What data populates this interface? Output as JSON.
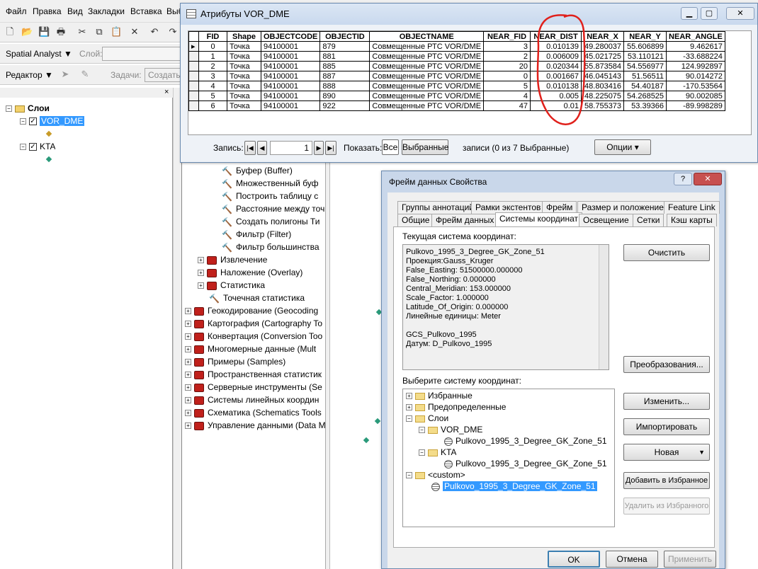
{
  "menu": {
    "items": [
      "Файл",
      "Правка",
      "Вид",
      "Закладки",
      "Вставка",
      "Выб"
    ]
  },
  "toolbar": {
    "spatial_analyst": "Spatial Analyst ▼",
    "layer_label": "Слой:",
    "editor": "Редактор ▼",
    "tasks_label": "Задачи:",
    "create_label": "Создать"
  },
  "toc": {
    "root": "Слои",
    "layers": [
      "VOR_DME",
      "KTA"
    ]
  },
  "toolbox": {
    "items": [
      {
        "label": "Буфер (Buffer)",
        "kind": "tool"
      },
      {
        "label": "Множественный буф",
        "kind": "tool"
      },
      {
        "label": "Построить таблицу с",
        "kind": "tool"
      },
      {
        "label": "Расстояние между точ",
        "kind": "tool"
      },
      {
        "label": "Создать полигоны Ти",
        "kind": "tool"
      },
      {
        "label": "Фильтр (Filter)",
        "kind": "tool"
      },
      {
        "label": "Фильтр большинства",
        "kind": "tool"
      },
      {
        "label": "Извлечение",
        "kind": "set"
      },
      {
        "label": "Наложение (Overlay)",
        "kind": "set"
      },
      {
        "label": "Статистика",
        "kind": "set"
      },
      {
        "label": "Точечная статистика",
        "kind": "tool2"
      },
      {
        "label": "Геокодирование (Geocoding",
        "kind": "box"
      },
      {
        "label": "Картография (Cartography To",
        "kind": "box"
      },
      {
        "label": "Конвертация (Conversion Too",
        "kind": "box"
      },
      {
        "label": "Многомерные данные (Mult",
        "kind": "box"
      },
      {
        "label": "Примеры (Samples)",
        "kind": "box"
      },
      {
        "label": "Пространственная статистик",
        "kind": "box"
      },
      {
        "label": "Серверные инструменты (Se",
        "kind": "box"
      },
      {
        "label": "Системы линейных координ",
        "kind": "box"
      },
      {
        "label": "Схематика (Schematics Tools",
        "kind": "box"
      },
      {
        "label": "Управление данными (Data M",
        "kind": "box"
      }
    ]
  },
  "attributes": {
    "title": "Атрибуты VOR_DME",
    "columns": [
      "FID",
      "Shape",
      "OBJECTCODE",
      "OBJECTID",
      "OBJECTNAME",
      "NEAR_FID",
      "NEAR_DIST",
      "NEAR_X",
      "NEAR_Y",
      "NEAR_ANGLE"
    ],
    "rows": [
      [
        "0",
        "Точка",
        "94100001",
        "879",
        "Совмещенные РТС VOR/DME",
        "3",
        "0.010139",
        "49.280037",
        "55.606899",
        "9.462617"
      ],
      [
        "1",
        "Точка",
        "94100001",
        "881",
        "Совмещенные РТС VOR/DME",
        "2",
        "0.006009",
        "45.021725",
        "53.110121",
        "-33.688224"
      ],
      [
        "2",
        "Точка",
        "94100001",
        "885",
        "Совмещенные РТС VOR/DME",
        "20",
        "0.020344",
        "55.873584",
        "54.556977",
        "124.992897"
      ],
      [
        "3",
        "Точка",
        "94100001",
        "887",
        "Совмещенные РТС VOR/DME",
        "0",
        "0.001667",
        "46.045143",
        "51.56511",
        "90.014272"
      ],
      [
        "4",
        "Точка",
        "94100001",
        "888",
        "Совмещенные РТС VOR/DME",
        "5",
        "0.010138",
        "48.803416",
        "54.40187",
        "-170.53564"
      ],
      [
        "5",
        "Точка",
        "94100001",
        "890",
        "Совмещенные РТС VOR/DME",
        "4",
        "0.005",
        "48.225075",
        "54.268525",
        "90.002085"
      ],
      [
        "6",
        "Точка",
        "94100001",
        "922",
        "Совмещенные РТС VOR/DME",
        "47",
        "0.01",
        "58.755373",
        "53.39366",
        "-89.998289"
      ]
    ],
    "record_label": "Запись:",
    "record_value": "1",
    "show_label": "Показать:",
    "show_all": "Все",
    "show_selected": "Выбранные",
    "records_info": "записи (0 из 7 Выбранные)",
    "options": "Опции"
  },
  "dialog": {
    "title": "Фрейм данных Свойства",
    "tabs_row1": [
      "Группы аннотаций",
      "Рамки экстентов",
      "Фрейм",
      "Размер и положение",
      "Feature Link"
    ],
    "tabs_row2": [
      "Общие",
      "Фрейм данных",
      "Системы координат",
      "Освещение",
      "Сетки",
      "Кэш карты"
    ],
    "current_label": "Текущая система координат:",
    "current_text": [
      "Pulkovo_1995_3_Degree_GK_Zone_51",
      "Проекция:Gauss_Kruger",
      "False_Easting: 51500000.000000",
      "False_Northing: 0.000000",
      "Central_Meridian: 153.000000",
      "Scale_Factor: 1.000000",
      "Latitude_Of_Origin: 0.000000",
      "Линейные единицы: Meter",
      "",
      "GCS_Pulkovo_1995",
      "Датум: D_Pulkovo_1995"
    ],
    "clear": "Очистить",
    "transform": "Преобразования...",
    "select_label": "Выберите систему координат:",
    "tree": {
      "favorites": "Избранные",
      "predefined": "Предопределенные",
      "layers": "Слои",
      "vor": "VOR_DME",
      "vor_cs": "Pulkovo_1995_3_Degree_GK_Zone_51",
      "kta": "KTA",
      "kta_cs": "Pulkovo_1995_3_Degree_GK_Zone_51",
      "custom": "<custom>",
      "custom_cs": "Pulkovo_1995_3_Degree_GK_Zone_51"
    },
    "modify": "Изменить...",
    "import": "Импортировать",
    "new": "Новая",
    "add_fav": "Добавить в Избранное",
    "remove_fav": "Удалить из Избранного",
    "ok": "OK",
    "cancel": "Отмена",
    "apply": "Применить"
  },
  "colors": {
    "highlight": "#3399ff",
    "annotation": "#e0201b",
    "toolbox_red": "#c0201b"
  }
}
